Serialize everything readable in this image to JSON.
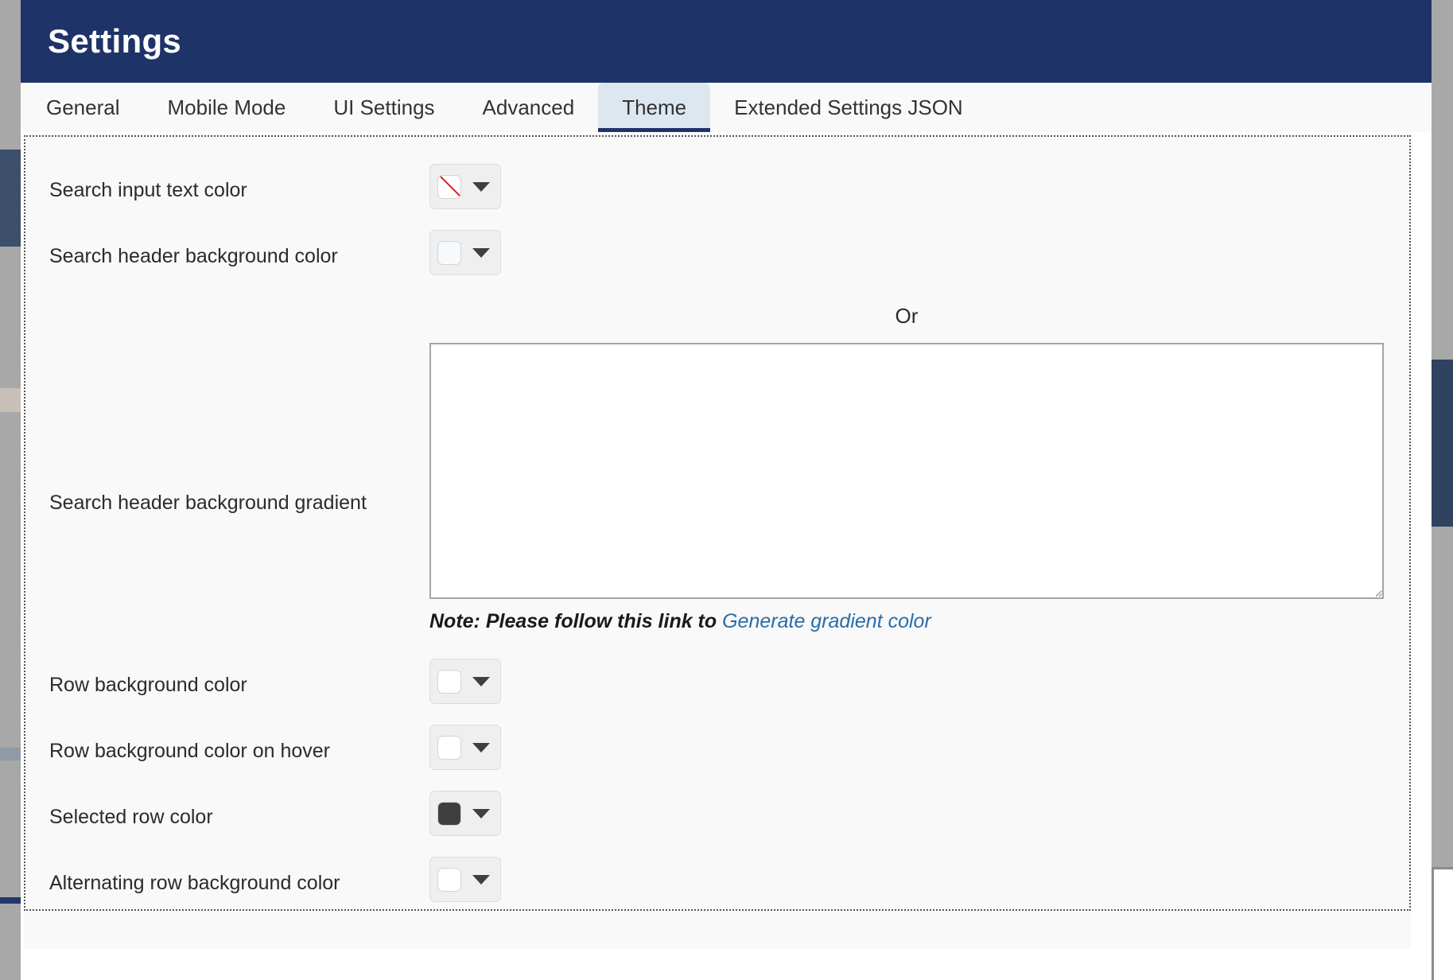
{
  "window": {
    "title": "Settings"
  },
  "tabs": [
    {
      "label": "General",
      "active": false
    },
    {
      "label": "Mobile Mode",
      "active": false
    },
    {
      "label": "UI Settings",
      "active": false
    },
    {
      "label": "Advanced",
      "active": false
    },
    {
      "label": "Theme",
      "active": true
    },
    {
      "label": "Extended Settings JSON",
      "active": false
    }
  ],
  "theme_panel": {
    "rows_top": [
      {
        "label": "Search input text color",
        "swatch": "none",
        "color": "#ffffff"
      },
      {
        "label": "Search header background color",
        "swatch": "color",
        "color": "#f6fafd"
      }
    ],
    "gradient": {
      "label": "Search header background gradient",
      "or_label": "Or",
      "textarea_value": "",
      "textarea_placeholder": "",
      "note_prefix": "Note: Please follow this link to ",
      "note_link": "Generate gradient color"
    },
    "rows_bottom": [
      {
        "label": "Row background color",
        "swatch": "color",
        "color": "#ffffff"
      },
      {
        "label": "Row background color on hover",
        "swatch": "color",
        "color": "#ffffff"
      },
      {
        "label": "Selected row color",
        "swatch": "color",
        "color": "#3f3f3f"
      },
      {
        "label": "Alternating row background color",
        "swatch": "color",
        "color": "#ffffff"
      }
    ]
  },
  "colors": {
    "titlebar_bg": "#1e3368",
    "active_tab_bg": "#dde7f0",
    "active_tab_underline": "#1e3368",
    "panel_bg": "#f9f9f9",
    "link": "#2a6ca8",
    "swatch_none_slash": "#e01b1b"
  }
}
